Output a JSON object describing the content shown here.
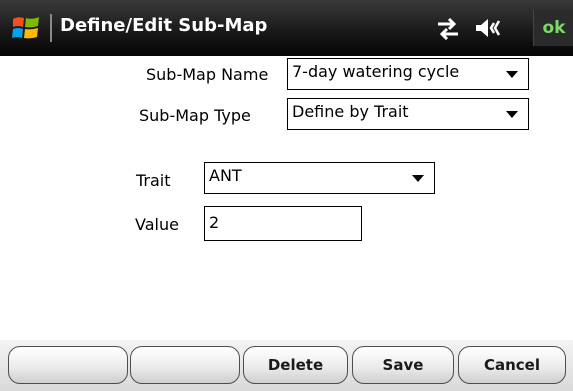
{
  "titlebar": {
    "title": "Define/Edit Sub-Map",
    "ok_label": "ok",
    "icons": [
      "windows-start-icon",
      "connectivity-icon",
      "volume-icon"
    ]
  },
  "form": {
    "submap_name": {
      "label": "Sub-Map Name",
      "value": "7-day watering cycle"
    },
    "submap_type": {
      "label": "Sub-Map Type",
      "value": "Define by Trait"
    },
    "trait": {
      "label": "Trait",
      "value": "ANT"
    },
    "value_field": {
      "label": "Value",
      "value": "2"
    }
  },
  "toolbar": {
    "buttons": [
      "",
      "",
      "Delete",
      "Save",
      "Cancel"
    ]
  },
  "colors": {
    "titlebar_bg": "#1a1a1a",
    "ok_color": "#7fd86a",
    "toolbar_bg": "#e6e6e6"
  }
}
